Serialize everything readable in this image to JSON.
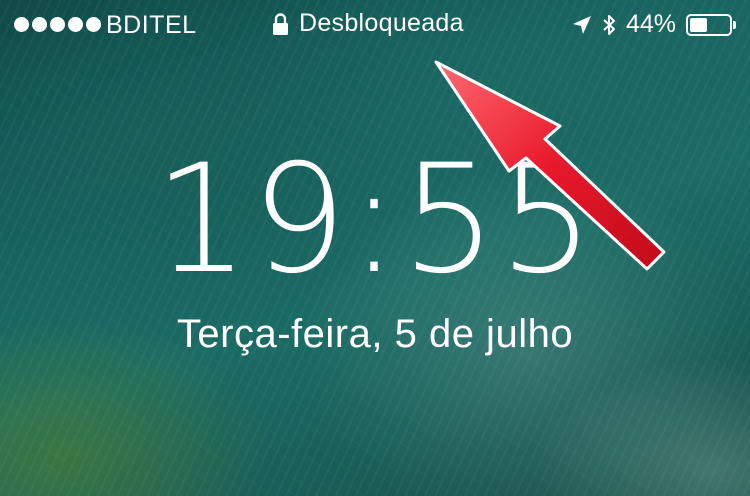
{
  "status_bar": {
    "signal_bars": 5,
    "carrier": "BDITEL",
    "lock_status": "Desbloqueada",
    "battery_percent": "44%",
    "battery_level": 0.44,
    "icons": [
      "signal-dots-icon",
      "lock-icon",
      "location-arrow-icon",
      "bluetooth-icon",
      "battery-icon"
    ]
  },
  "lock_screen": {
    "time": "19:55",
    "date": "Terça-feira, 5 de julho"
  },
  "annotation": {
    "icon": "red-arrow-icon",
    "color": "#e8192c"
  }
}
